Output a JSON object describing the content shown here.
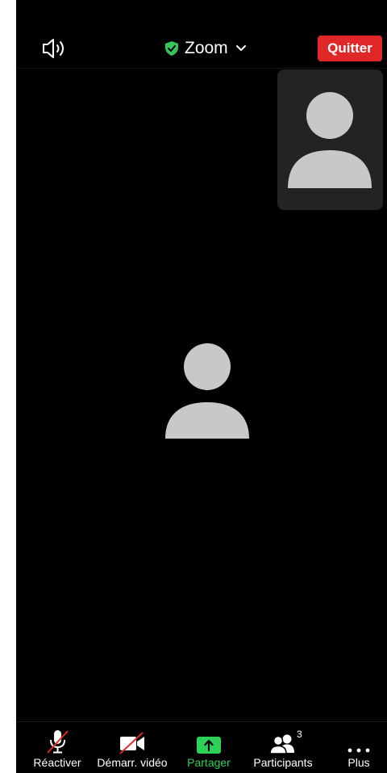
{
  "header": {
    "speaker_icon": "speaker-icon",
    "meeting_title": "Zoom",
    "secure_icon": "shield-check-icon",
    "dropdown_icon": "chevron-down-icon",
    "quit_label": "Quitter"
  },
  "participants_video": {
    "thumbnail_icon": "avatar-icon",
    "main_icon": "avatar-icon"
  },
  "toolbar": {
    "items": [
      {
        "label": "Réactiver",
        "icon": "microphone-muted-icon"
      },
      {
        "label": "Démarr. vidéo",
        "icon": "video-off-icon"
      },
      {
        "label": "Partager",
        "icon": "share-screen-icon"
      },
      {
        "label": "Participants",
        "icon": "participants-icon",
        "count": "3"
      },
      {
        "label": "Plus",
        "icon": "more-dots-icon"
      }
    ]
  },
  "colors": {
    "background": "#000000",
    "quit": "#e02828",
    "share": "#2ed157",
    "shield": "#35c35a",
    "avatar": "#c8c8c8",
    "thumbnail_bg": "#232323"
  }
}
